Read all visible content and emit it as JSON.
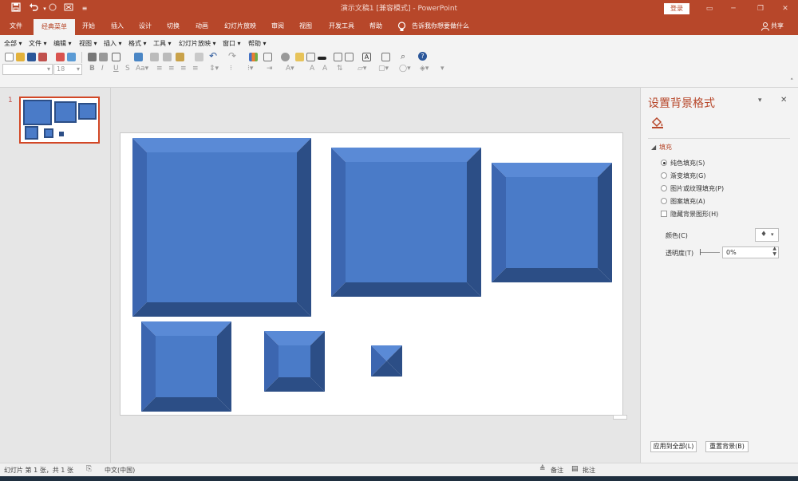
{
  "window": {
    "title": "演示文稿1 [兼容模式]  -  PowerPoint",
    "login_label": "登录",
    "qa_icons": [
      "save-icon",
      "undo-icon",
      "redo-icon",
      "repeat-icon",
      "customize-icon"
    ]
  },
  "tabs": [
    {
      "label": "文件"
    },
    {
      "label": "经典菜单"
    },
    {
      "label": "开始"
    },
    {
      "label": "插入"
    },
    {
      "label": "设计"
    },
    {
      "label": "切换"
    },
    {
      "label": "动画"
    },
    {
      "label": "幻灯片放映"
    },
    {
      "label": "审阅"
    },
    {
      "label": "视图"
    },
    {
      "label": "开发工具"
    },
    {
      "label": "帮助"
    }
  ],
  "tell_me": "告诉我你想要做什么",
  "share_label": "共享",
  "classic_menu": [
    "全部",
    "文件",
    "编辑",
    "视图",
    "插入",
    "格式",
    "工具",
    "幻灯片放映",
    "窗口",
    "帮助"
  ],
  "font": {
    "size": "18"
  },
  "thumbnail": {
    "number": "1"
  },
  "pane": {
    "title": "设置背景格式",
    "section": "填充",
    "options": [
      {
        "label": "纯色填充(S)",
        "selected": true
      },
      {
        "label": "渐变填充(G)",
        "selected": false
      },
      {
        "label": "图片或纹理填充(P)",
        "selected": false
      },
      {
        "label": "图案填充(A)",
        "selected": false
      }
    ],
    "hide_graphics": "隐藏背景图形(H)",
    "color_label": "颜色(C)",
    "transparency_label": "透明度(T)",
    "transparency_value": "0%",
    "apply_all": "应用到全部(L)",
    "reset": "重置背景(B)"
  },
  "status": {
    "slide_info": "幻灯片 第 1 张，共 1 张",
    "language": "中文(中国)",
    "notes": "备注",
    "comments": "批注"
  },
  "colors": {
    "accent": "#b7472a",
    "bevel_face": "#4a7bc8",
    "bevel_light": "#5a8ad6",
    "bevel_dark": "#2c4e86"
  }
}
